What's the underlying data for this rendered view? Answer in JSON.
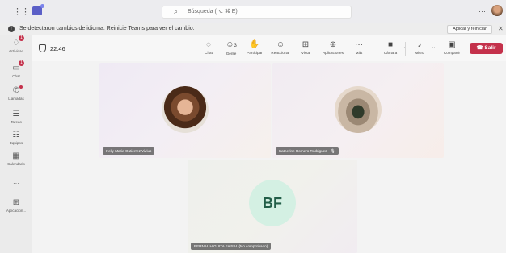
{
  "titlebar": {
    "search_placeholder": "Búsqueda (⌥ ⌘ E)",
    "more_icon": "more-horizontal-icon",
    "profile_avatar": "profile-avatar"
  },
  "banner": {
    "message": "Se detectaron cambios de idioma. Reinicie Teams para ver el cambio.",
    "action_label": "Aplicar y reiniciar",
    "close_label": "✕"
  },
  "rail": {
    "items": [
      {
        "label": "Actividad",
        "icon": "bell-icon",
        "badge": "1"
      },
      {
        "label": "Chat",
        "icon": "chat-icon",
        "badge": "1"
      },
      {
        "label": "Llamadas",
        "icon": "phone-icon",
        "dot": true
      },
      {
        "label": "Tareas",
        "icon": "tasks-icon"
      },
      {
        "label": "Equipos",
        "icon": "teams-icon"
      },
      {
        "label": "Calendario",
        "icon": "calendar-icon"
      },
      {
        "label": "···",
        "icon": "more-icon"
      },
      {
        "label": "Aplicacion...",
        "icon": "apps-icon"
      }
    ]
  },
  "toolbar": {
    "timer": "22:46",
    "tools": [
      {
        "label": "Chat",
        "icon": "chat-icon"
      },
      {
        "label": "Gente",
        "icon": "people-icon",
        "count": "3"
      },
      {
        "label": "Participar",
        "icon": "raise-hand-icon"
      },
      {
        "label": "Reaccionar",
        "icon": "react-icon"
      },
      {
        "label": "Vista",
        "icon": "view-icon"
      },
      {
        "label": "Aplicaciones",
        "icon": "apps-icon"
      },
      {
        "label": "Más",
        "icon": "more-icon"
      },
      {
        "label": "Cámara",
        "icon": "camera-off-icon"
      },
      {
        "label": "Micro",
        "icon": "mic-icon"
      },
      {
        "label": "Compartir",
        "icon": "share-icon"
      }
    ],
    "leave_label": "Salir"
  },
  "participants": [
    {
      "name": "Kelly Maria Gutierrez Vivius",
      "type": "photo"
    },
    {
      "name": "Katherine Romero Rodriguez",
      "type": "photo",
      "muted": true
    },
    {
      "name": "BERNAL HIGUITA FAISAL (No comprobado)",
      "type": "initials",
      "initials": "BF"
    }
  ],
  "colors": {
    "brand": "#5b5fc7",
    "leave": "#c4314b",
    "initials_bg": "#d4f0e3",
    "initials_fg": "#225e48"
  }
}
